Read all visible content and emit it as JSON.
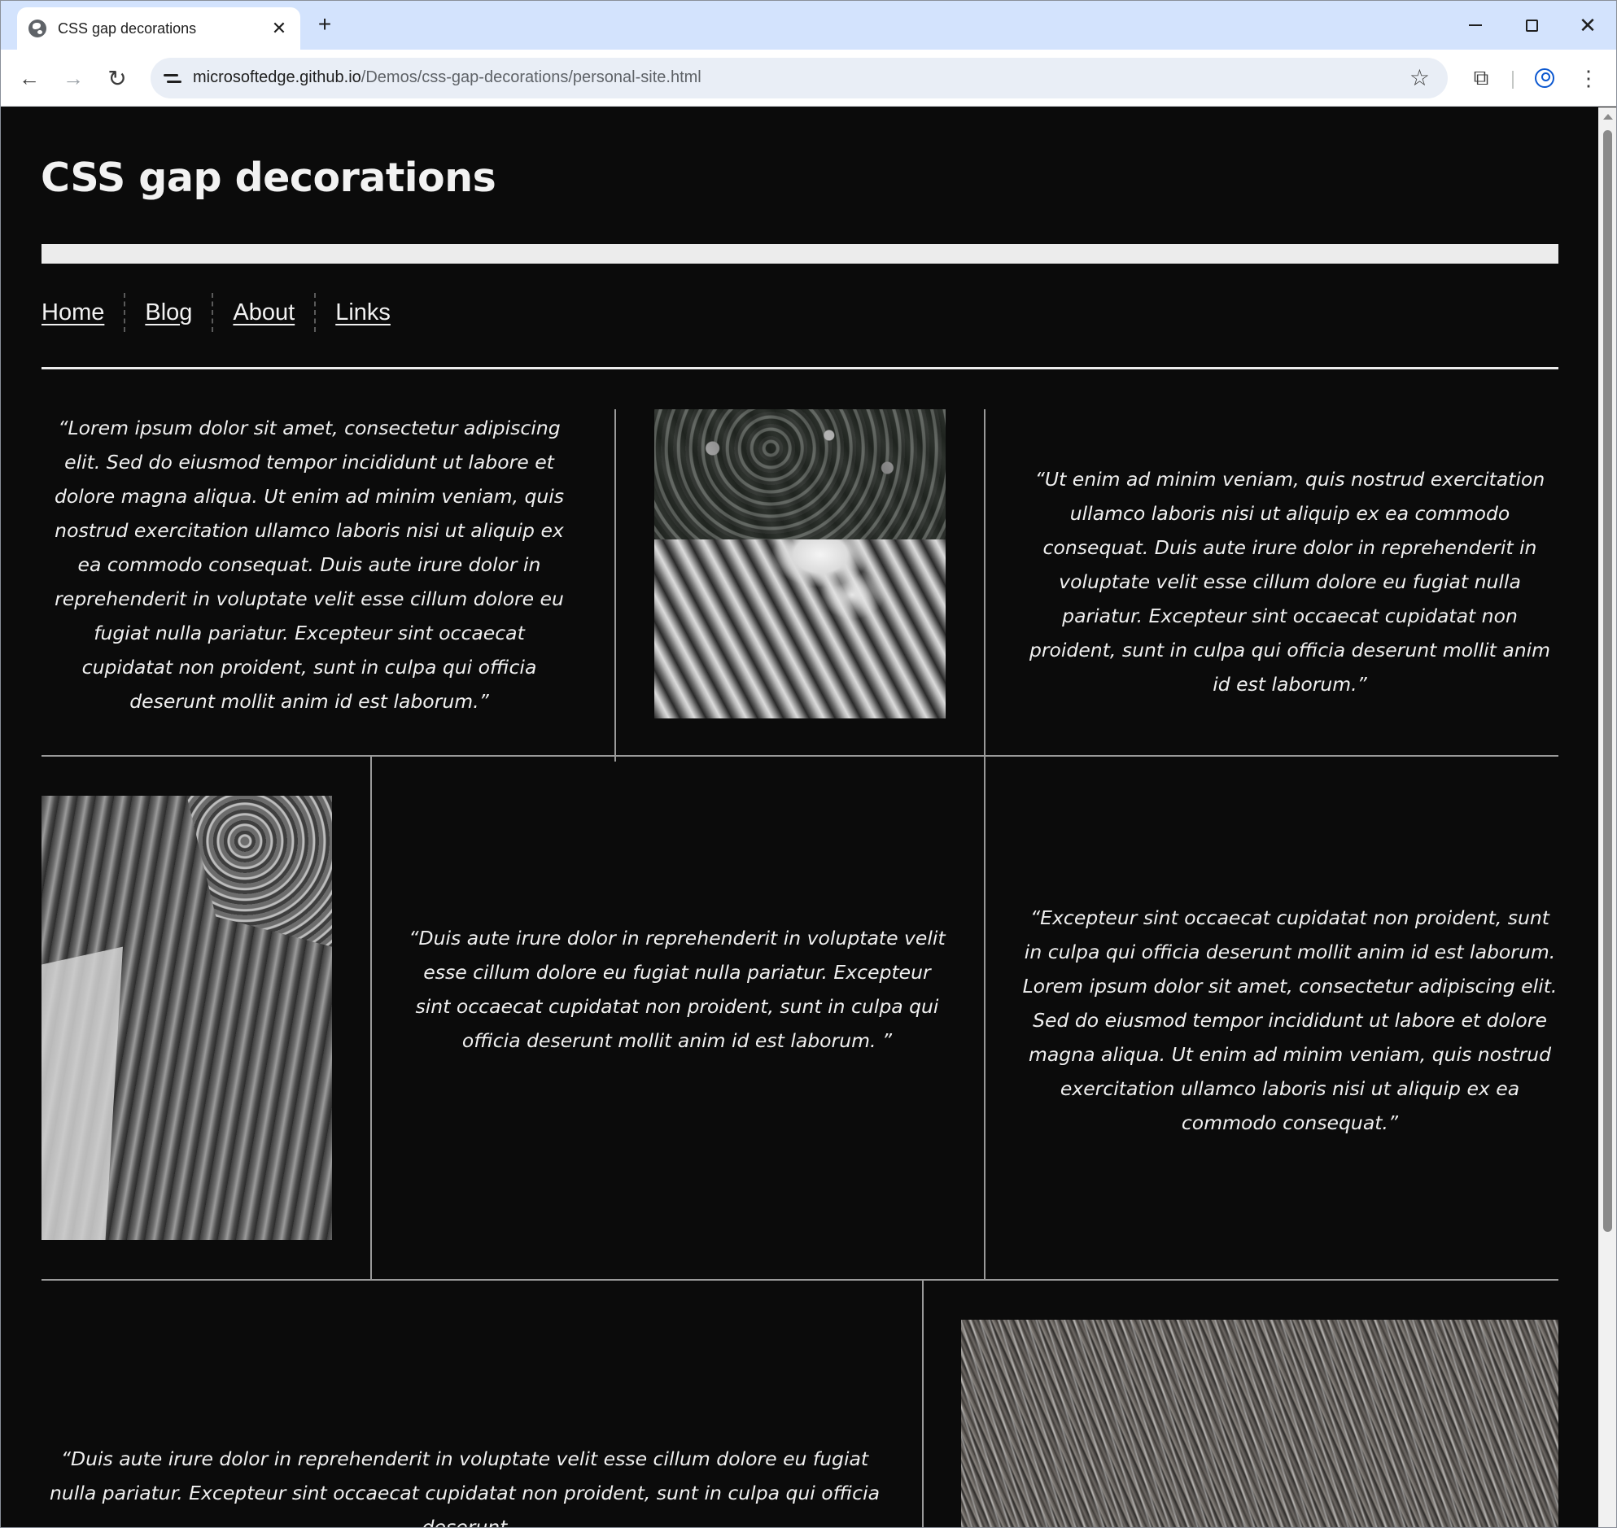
{
  "browser": {
    "tab_title": "CSS gap decorations",
    "tab_close_glyph": "✕",
    "new_tab_glyph": "+",
    "url_host": "microsoftedge.github.io",
    "url_path": "/Demos/css-gap-decorations/personal-site.html",
    "icons": {
      "favicon": "globe-icon",
      "back": "arrow-left-icon",
      "forward": "arrow-right-icon",
      "reload": "reload-icon",
      "site_info": "tune-icon",
      "bookmark": "star-icon",
      "extensions": "puzzle-icon",
      "profile": "profile-icon",
      "menu": "kebab-menu-icon",
      "close": "close-icon"
    },
    "glyphs": {
      "back": "←",
      "forward": "→",
      "reload": "↻",
      "star": "☆",
      "extensions": "⧉",
      "menu": "⋮",
      "close": "✕"
    }
  },
  "page": {
    "title": "CSS gap decorations",
    "nav": [
      {
        "label": "Home"
      },
      {
        "label": "Blog"
      },
      {
        "label": "About"
      },
      {
        "label": "Links"
      }
    ],
    "quotes": {
      "q1": "“Lorem ipsum dolor sit amet, consectetur adipiscing elit. Sed do eiusmod tempor incididunt ut labore et dolore magna aliqua. Ut enim ad minim veniam, quis nostrud exercitation ullamco laboris nisi ut aliquip ex ea commodo consequat. Duis aute irure dolor in reprehenderit in voluptate velit esse cillum dolore eu fugiat nulla pariatur. Excepteur sint occaecat cupidatat non proident, sunt in culpa qui officia deserunt mollit anim id est laborum.”",
      "q2": "“Ut enim ad minim veniam, quis nostrud exercitation ullamco laboris nisi ut aliquip ex ea commodo consequat. Duis aute irure dolor in reprehenderit in voluptate velit esse cillum dolore eu fugiat nulla pariatur. Excepteur sint occaecat cupidatat non proident, sunt in culpa qui officia deserunt mollit anim id est laborum.”",
      "q3": "“Duis aute irure dolor in reprehenderit in voluptate velit esse cillum dolore eu fugiat nulla pariatur. Excepteur sint occaecat cupidatat non proident, sunt in culpa qui officia deserunt mollit anim id est laborum. ”",
      "q4": "“Excepteur sint occaecat cupidatat non proident, sunt in culpa qui officia deserunt mollit anim id est laborum. Lorem ipsum dolor sit amet, consectetur adipiscing elit. Sed do eiusmod tempor incididunt ut labore et dolore magna aliqua. Ut enim ad minim veniam, quis nostrud exercitation ullamco laboris nisi ut aliquip ex ea commodo consequat.”",
      "q5": "“Duis aute irure dolor in reprehenderit in voluptate velit esse cillum dolore eu fugiat nulla pariatur. Excepteur sint occaecat cupidatat non proident, sunt in culpa qui officia deserunt"
    },
    "colors": {
      "background": "#0b0b0b",
      "text": "#f0f0f0",
      "rule": "#9a9a9a",
      "title_bar": "#ececec",
      "tabstrip": "#d3e3fd"
    }
  }
}
